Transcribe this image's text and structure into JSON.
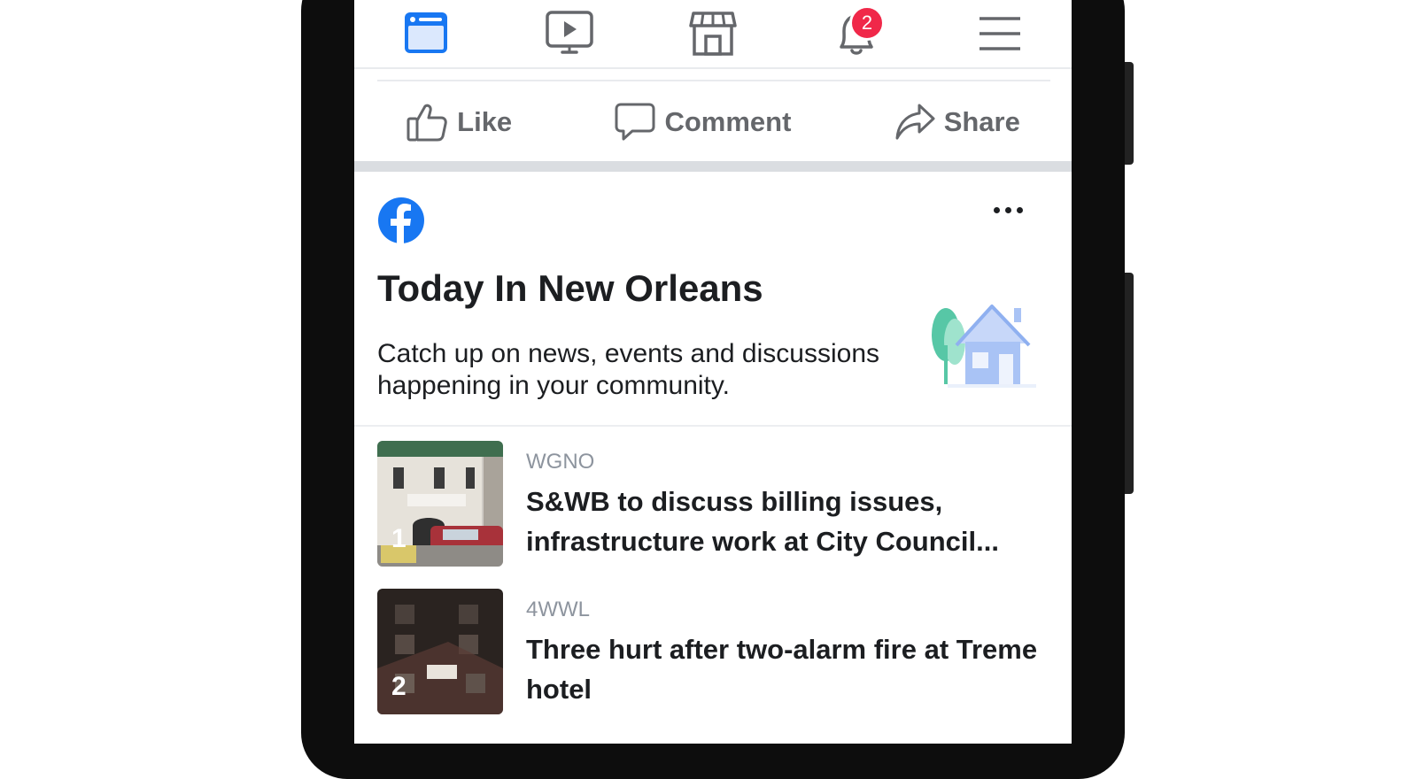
{
  "nav": {
    "items": [
      {
        "icon": "news-feed-icon",
        "active": true
      },
      {
        "icon": "watch-icon",
        "active": false
      },
      {
        "icon": "marketplace-icon",
        "active": false
      },
      {
        "icon": "notifications-icon",
        "active": false
      },
      {
        "icon": "menu-icon",
        "active": false
      }
    ],
    "notification_count": "2"
  },
  "post_actions": {
    "like_label": "Like",
    "comment_label": "Comment",
    "share_label": "Share"
  },
  "card": {
    "title": "Today In New Orleans",
    "description": "Catch up on news, events and discussions happening in your community."
  },
  "news": [
    {
      "rank": "1",
      "source": "WGNO",
      "headline": "S&WB to discuss billing issues, infrastructure work at City Council..."
    },
    {
      "rank": "2",
      "source": "4WWL",
      "headline": "Three hurt after two-alarm fire at Treme hotel"
    }
  ],
  "colors": {
    "accent": "#1877f2",
    "icon_gray": "#65676b",
    "badge": "#f02849",
    "text": "#1c1e21",
    "muted": "#8d949e"
  }
}
